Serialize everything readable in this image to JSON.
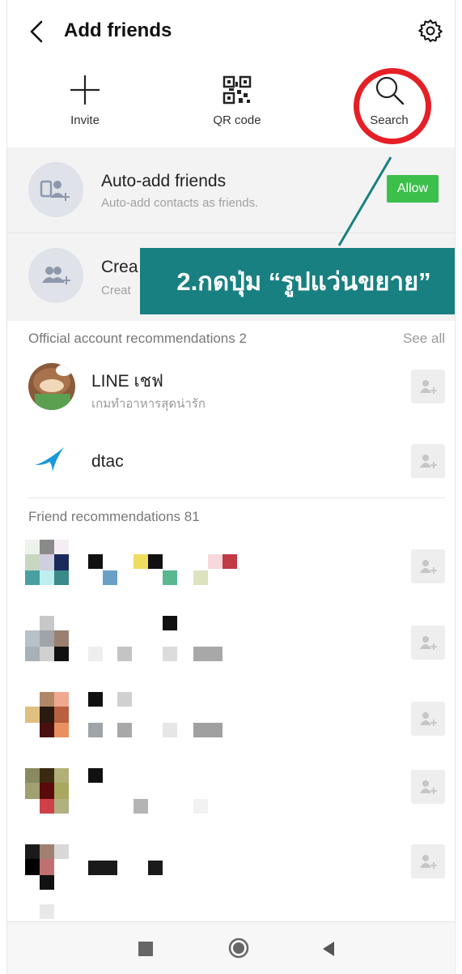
{
  "header": {
    "title": "Add friends"
  },
  "actions": [
    {
      "label": "Invite",
      "icon": "plus-icon"
    },
    {
      "label": "QR code",
      "icon": "qr-code-icon"
    },
    {
      "label": "Search",
      "icon": "search-icon"
    }
  ],
  "auto_add": {
    "title": "Auto-add friends",
    "subtitle": "Auto-add contacts as friends.",
    "button": "Allow"
  },
  "create_group": {
    "title": "Crea",
    "subtitle": "Creat"
  },
  "overlay": {
    "text": "2.กดปุ่ม “รูปแว่นขยาย”"
  },
  "official": {
    "header": "Official account recommendations 2",
    "see_all": "See all",
    "items": [
      {
        "name": "LINE เชฟ",
        "desc": "เกมทำอาหารสุดน่ารัก"
      },
      {
        "name": "dtac",
        "desc": ""
      }
    ]
  },
  "friends": {
    "header": "Friend recommendations 81"
  },
  "colors": {
    "accent_green": "#3cbf4b",
    "overlay_teal": "#198081",
    "highlight_red": "#e51f26"
  }
}
